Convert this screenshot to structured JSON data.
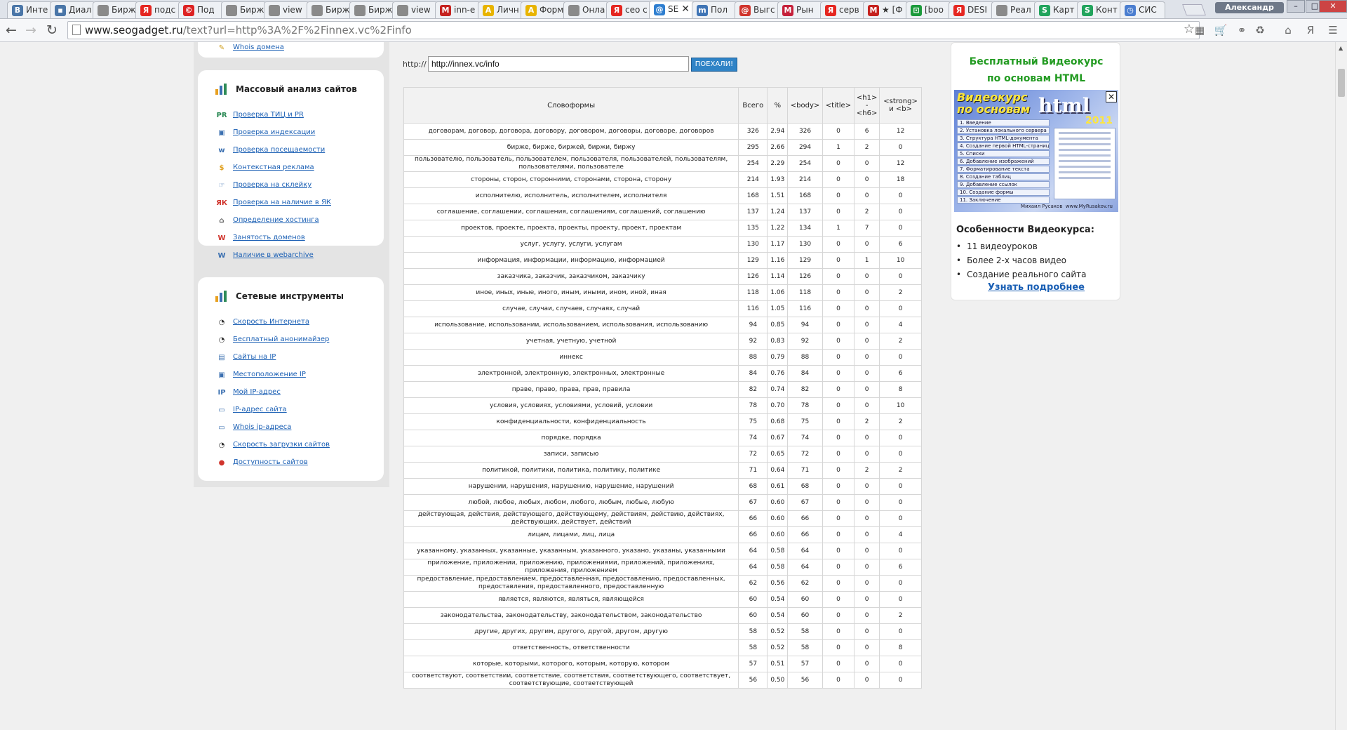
{
  "browser": {
    "tabs": [
      {
        "label": "Инте",
        "icon": "vk-icon",
        "color": "#4a76a8",
        "glyph": "В"
      },
      {
        "label": "Диал",
        "icon": "chat-icon",
        "color": "#4a76a8",
        "glyph": "▪"
      },
      {
        "label": "Бирж",
        "icon": "page-icon",
        "color": "#8a8a8a",
        "glyph": ""
      },
      {
        "label": "подс",
        "icon": "yandex-icon",
        "color": "#e52620",
        "glyph": "Я"
      },
      {
        "label": "Под",
        "icon": "copyright-icon",
        "color": "#d22",
        "glyph": "©"
      },
      {
        "label": "Бирж",
        "icon": "page-icon",
        "color": "#8a8a8a",
        "glyph": ""
      },
      {
        "label": "view",
        "icon": "page-icon",
        "color": "#8a8a8a",
        "glyph": ""
      },
      {
        "label": "Бирж",
        "icon": "page-icon",
        "color": "#8a8a8a",
        "glyph": ""
      },
      {
        "label": "Бирж",
        "icon": "page-icon",
        "color": "#8a8a8a",
        "glyph": ""
      },
      {
        "label": "view",
        "icon": "page-icon",
        "color": "#8a8a8a",
        "glyph": ""
      },
      {
        "label": "inn-e",
        "icon": "gmail-icon",
        "color": "#c5221f",
        "glyph": "M"
      },
      {
        "label": "Личн",
        "icon": "a-icon",
        "color": "#e8b400",
        "glyph": "A"
      },
      {
        "label": "Форм",
        "icon": "a-icon",
        "color": "#e8b400",
        "glyph": "A"
      },
      {
        "label": "Онла",
        "icon": "page-icon",
        "color": "#8a8a8a",
        "glyph": ""
      },
      {
        "label": "сео с",
        "icon": "yandex-icon",
        "color": "#e52620",
        "glyph": "Я"
      },
      {
        "label": "SE",
        "icon": "seo-icon",
        "color": "#2f7fd0",
        "glyph": "@"
      },
      {
        "label": "Пол",
        "icon": "m-icon",
        "color": "#3f74b5",
        "glyph": "m"
      },
      {
        "label": "Выгс",
        "icon": "swirl-icon",
        "color": "#d0342c",
        "glyph": "@"
      },
      {
        "label": "Рын",
        "icon": "m-icon",
        "color": "#c5203a",
        "glyph": "M"
      },
      {
        "label": "серв",
        "icon": "yandex-icon",
        "color": "#e52620",
        "glyph": "Я"
      },
      {
        "label": "★ [Ф",
        "icon": "gmail-icon",
        "color": "#c5221f",
        "glyph": "M"
      },
      {
        "label": "[boo",
        "icon": "chart-icon",
        "color": "#1b9a3b",
        "glyph": "⊡"
      },
      {
        "label": "DESI",
        "icon": "yandex-icon",
        "color": "#e52620",
        "glyph": "Я"
      },
      {
        "label": "Реал",
        "icon": "page-icon",
        "color": "#8a8a8a",
        "glyph": ""
      },
      {
        "label": "Карт",
        "icon": "s-icon",
        "color": "#22a45d",
        "glyph": "S"
      },
      {
        "label": "Конт",
        "icon": "s-icon",
        "color": "#22a45d",
        "glyph": "S"
      },
      {
        "label": "СИС",
        "icon": "clock-icon",
        "color": "#4b7ed0",
        "glyph": "◷"
      }
    ],
    "active_tab": 15,
    "user": "Александр",
    "url_domain": "www.seogadget.ru",
    "url_path": "/text?url=http%3A%2F%2Finnex.vc%2Finfo"
  },
  "sidebar": {
    "top_link": "Whois домена",
    "sections": [
      {
        "title": "Массовый анализ сайтов",
        "items": [
          {
            "label": "Проверка ТИЦ и PR",
            "icon": "tic-pr-icon",
            "color": "#2e8b57",
            "glyph": "PR"
          },
          {
            "label": "Проверка индексации",
            "icon": "monitor-icon",
            "color": "#3a6fb0",
            "glyph": "▣"
          },
          {
            "label": "Проверка посещаемости",
            "icon": "www-icon",
            "color": "#3a6fb0",
            "glyph": "w"
          },
          {
            "label": "Контекстная реклама",
            "icon": "coins-icon",
            "color": "#e0a020",
            "glyph": "$"
          },
          {
            "label": "Проверка на склейку",
            "icon": "hand-icon",
            "color": "#3a6fb0",
            "glyph": "☞"
          },
          {
            "label": "Проверка на наличие в ЯК",
            "icon": "yk-icon",
            "color": "#d0342c",
            "glyph": "ЯК"
          },
          {
            "label": "Определение хостинга",
            "icon": "house-icon",
            "color": "#555555",
            "glyph": "⌂"
          },
          {
            "label": "Занятость доменов",
            "icon": "domain-icon",
            "color": "#d0342c",
            "glyph": "W"
          },
          {
            "label": "Наличие в webarchive",
            "icon": "archive-icon",
            "color": "#3a6fb0",
            "glyph": "W"
          }
        ]
      },
      {
        "title": "Сетевые инструменты",
        "items": [
          {
            "label": "Скорость Интернета",
            "icon": "speedometer-icon",
            "color": "#333333",
            "glyph": "◔"
          },
          {
            "label": "Бесплатный анонимайзер",
            "icon": "speedometer-icon",
            "color": "#333333",
            "glyph": "◔"
          },
          {
            "label": "Сайты на IP",
            "icon": "sites-icon",
            "color": "#3a6fb0",
            "glyph": "▤"
          },
          {
            "label": "Местоположение IP",
            "icon": "monitor-icon",
            "color": "#3a6fb0",
            "glyph": "▣"
          },
          {
            "label": "Мой IP-адрес",
            "icon": "ip-icon",
            "color": "#3a6fb0",
            "glyph": "IP"
          },
          {
            "label": "IP-адрес сайта",
            "icon": "laptop-icon",
            "color": "#3a6fb0",
            "glyph": "▭"
          },
          {
            "label": "Whois ip-адреса",
            "icon": "laptop-icon",
            "color": "#3a6fb0",
            "glyph": "▭"
          },
          {
            "label": "Скорость загрузки сайтов",
            "icon": "speedometer-icon",
            "color": "#333333",
            "glyph": "◔"
          },
          {
            "label": "Доступность сайтов",
            "icon": "availability-icon",
            "color": "#d0342c",
            "glyph": "●"
          }
        ]
      }
    ]
  },
  "form": {
    "prefix": "http://",
    "url_value": "http://innex.vc/info",
    "submit": "ПОЕХАЛИ!"
  },
  "table": {
    "headers": [
      "Словоформы",
      "Всего",
      "%",
      "<body>",
      "<title>",
      "<h1>\n-\n<h6>",
      "<strong>\nи <b>"
    ],
    "rows": [
      [
        "договорам, договор, договора, договору, договором, договоры, договоре, договоров",
        "326",
        "2.94",
        "326",
        "0",
        "6",
        "12"
      ],
      [
        "бирже, бирже, биржей, биржи, биржу",
        "295",
        "2.66",
        "294",
        "1",
        "2",
        "0"
      ],
      [
        "пользователю, пользователь, пользователем, пользователя, пользователей, пользователям, пользователями, пользователе",
        "254",
        "2.29",
        "254",
        "0",
        "0",
        "12"
      ],
      [
        "стороны, сторон, сторонними, сторонами, сторона, сторону",
        "214",
        "1.93",
        "214",
        "0",
        "0",
        "18"
      ],
      [
        "исполнителю, исполнитель, исполнителем, исполнителя",
        "168",
        "1.51",
        "168",
        "0",
        "0",
        "0"
      ],
      [
        "соглашение, соглашении, соглашения, соглашениям, соглашений, соглашению",
        "137",
        "1.24",
        "137",
        "0",
        "2",
        "0"
      ],
      [
        "проектов, проекте, проекта, проекты, проекту, проект, проектам",
        "135",
        "1.22",
        "134",
        "1",
        "7",
        "0"
      ],
      [
        "услуг, услугу, услуги, услугам",
        "130",
        "1.17",
        "130",
        "0",
        "0",
        "6"
      ],
      [
        "информация, информации, информацию, информацией",
        "129",
        "1.16",
        "129",
        "0",
        "1",
        "10"
      ],
      [
        "заказчика, заказчик, заказчиком, заказчику",
        "126",
        "1.14",
        "126",
        "0",
        "0",
        "0"
      ],
      [
        "иное, иных, иные, иного, иным, иными, ином, иной, иная",
        "118",
        "1.06",
        "118",
        "0",
        "0",
        "2"
      ],
      [
        "случае, случаи, случаев, случаях, случай",
        "116",
        "1.05",
        "116",
        "0",
        "0",
        "0"
      ],
      [
        "использование, использовании, использованием, использования, использованию",
        "94",
        "0.85",
        "94",
        "0",
        "0",
        "4"
      ],
      [
        "учетная, учетную, учетной",
        "92",
        "0.83",
        "92",
        "0",
        "0",
        "2"
      ],
      [
        "иннекс",
        "88",
        "0.79",
        "88",
        "0",
        "0",
        "0"
      ],
      [
        "электронной, электронную, электронных, электронные",
        "84",
        "0.76",
        "84",
        "0",
        "0",
        "6"
      ],
      [
        "праве, право, права, прав, правила",
        "82",
        "0.74",
        "82",
        "0",
        "0",
        "8"
      ],
      [
        "условия, условиях, условиями, условий, условии",
        "78",
        "0.70",
        "78",
        "0",
        "0",
        "10"
      ],
      [
        "конфиденциальности, конфиденциальность",
        "75",
        "0.68",
        "75",
        "0",
        "2",
        "2"
      ],
      [
        "порядке, порядка",
        "74",
        "0.67",
        "74",
        "0",
        "0",
        "0"
      ],
      [
        "записи, записью",
        "72",
        "0.65",
        "72",
        "0",
        "0",
        "0"
      ],
      [
        "политикой, политики, политика, политику, политике",
        "71",
        "0.64",
        "71",
        "0",
        "2",
        "2"
      ],
      [
        "нарушении, нарушения, нарушению, нарушение, нарушений",
        "68",
        "0.61",
        "68",
        "0",
        "0",
        "0"
      ],
      [
        "любой, любое, любых, любом, любого, любым, любые, любую",
        "67",
        "0.60",
        "67",
        "0",
        "0",
        "0"
      ],
      [
        "действующая, действия, действующего, действующему, действиям, действию, действиях, действующих, действует, действий",
        "66",
        "0.60",
        "66",
        "0",
        "0",
        "0"
      ],
      [
        "лицам, лицами, лиц, лица",
        "66",
        "0.60",
        "66",
        "0",
        "0",
        "4"
      ],
      [
        "указанному, указанных, указанные, указанным, указанного, указано, указаны, указанными",
        "64",
        "0.58",
        "64",
        "0",
        "0",
        "0"
      ],
      [
        "приложение, приложении, приложению, приложениями, приложений, приложениях, приложения, приложением",
        "64",
        "0.58",
        "64",
        "0",
        "0",
        "6"
      ],
      [
        "предоставление, предоставлением, предоставленная, предоставлению, предоставленных, предоставления, предоставленного, предоставленную",
        "62",
        "0.56",
        "62",
        "0",
        "0",
        "0"
      ],
      [
        "является, являются, являться, являющейся",
        "60",
        "0.54",
        "60",
        "0",
        "0",
        "0"
      ],
      [
        "законодательства, законодательству, законодательством, законодательство",
        "60",
        "0.54",
        "60",
        "0",
        "0",
        "2"
      ],
      [
        "другие, других, другим, другого, другой, другом, другую",
        "58",
        "0.52",
        "58",
        "0",
        "0",
        "0"
      ],
      [
        "ответственность, ответственности",
        "58",
        "0.52",
        "58",
        "0",
        "0",
        "8"
      ],
      [
        "которые, которыми, которого, которым, которую, котором",
        "57",
        "0.51",
        "57",
        "0",
        "0",
        "0"
      ],
      [
        "соответствуют, соответствии, соответствие, соответствия, соответствующего, соответствует, соответствующие, соответствующей",
        "56",
        "0.50",
        "56",
        "0",
        "0",
        "0"
      ]
    ]
  },
  "ad": {
    "title_line1": "Бесплатный Видеокурс",
    "title_line2": "по основам HTML",
    "image_brand": "Видеокурс по основам",
    "image_word": "html",
    "image_year": "2011",
    "image_lessons": [
      "1. Введение",
      "2. Установка локального сервера",
      "3. Структура HTML-документа",
      "4. Создание первой HTML-страницы",
      "5. Списки",
      "6. Добавление изображений",
      "7. Форматирование текста",
      "8. Создание таблиц",
      "9. Добавление ссылок",
      "10. Создание формы",
      "11. Заключение"
    ],
    "image_author": "Михаил Русаков",
    "image_site": "www.MyRusakov.ru",
    "features_title": "Особенности Видеокурса:",
    "features": [
      "11 видеоуроков",
      "Более 2-х часов видео",
      "Создание реального сайта"
    ],
    "more_link": "Узнать подробнее"
  }
}
